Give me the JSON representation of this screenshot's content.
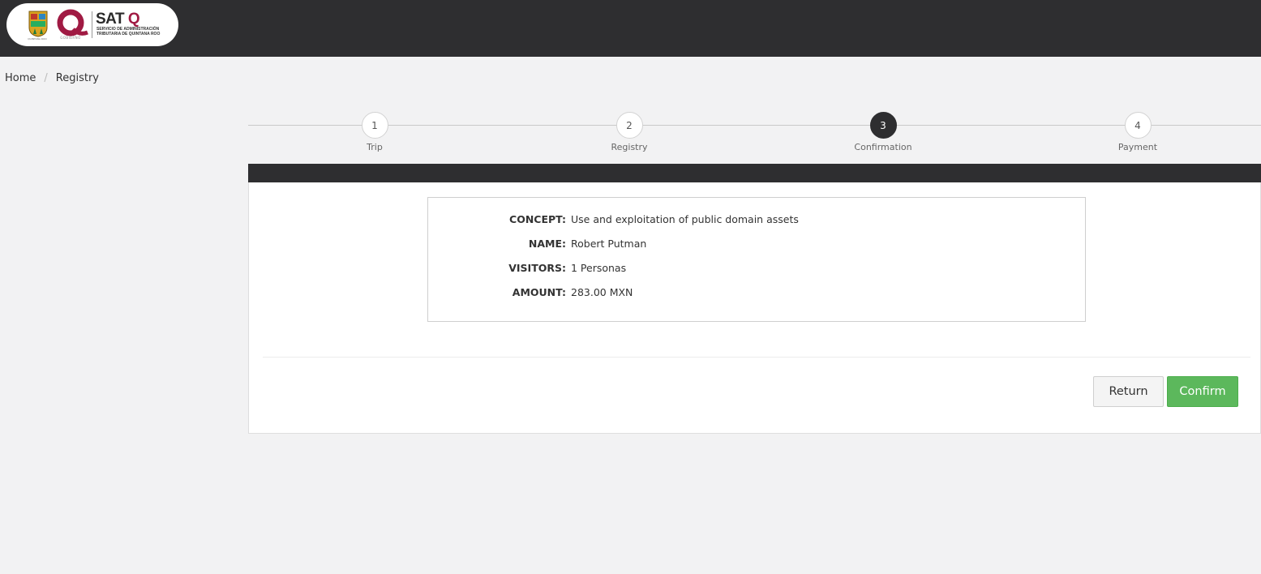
{
  "header": {
    "logo": {
      "brand_main": "SAT",
      "brand_q": "Q",
      "brand_sub_line1": "SERVICIO DE ADMINISTRACIÓN",
      "brand_sub_line2": "TRIBUTARIA DE QUINTANA ROO",
      "shield_caption": "QUINTANA ROO",
      "q_caption": "GOBIERNO",
      "colors": {
        "bar": "#2e2e30",
        "q_accent": "#a01a43"
      }
    }
  },
  "breadcrumb": {
    "items": [
      "Home",
      "Registry"
    ],
    "separator": "/"
  },
  "steps": [
    {
      "number": "1",
      "label": "Trip",
      "active": false
    },
    {
      "number": "2",
      "label": "Registry",
      "active": false
    },
    {
      "number": "3",
      "label": "Confirmation",
      "active": true
    },
    {
      "number": "4",
      "label": "Payment",
      "active": false
    }
  ],
  "summary": {
    "rows": [
      {
        "key": "CONCEPT:",
        "value": "Use and exploitation of public domain assets"
      },
      {
        "key": "NAME:",
        "value": "Robert Putman"
      },
      {
        "key": "VISITORS:",
        "value": "1 Personas"
      },
      {
        "key": "AMOUNT:",
        "value": "283.00 MXN"
      }
    ]
  },
  "actions": {
    "return_label": "Return",
    "confirm_label": "Confirm",
    "confirm_color": "#5cb85c"
  }
}
